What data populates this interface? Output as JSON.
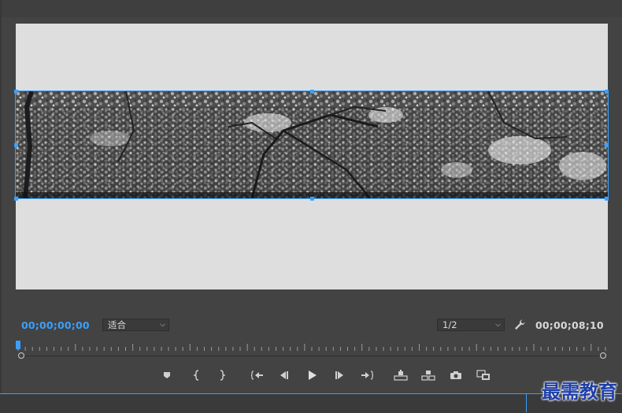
{
  "program_monitor": {
    "current_timecode": "00;00;00;00",
    "duration_timecode": "00;00;08;10",
    "zoom_level": "适合",
    "playback_resolution": "1/2"
  },
  "transport_controls": [
    {
      "name": "add-marker-button",
      "icon": "marker-icon"
    },
    {
      "name": "mark-in-button",
      "icon": "mark-in-icon"
    },
    {
      "name": "mark-out-button",
      "icon": "mark-out-icon"
    },
    {
      "name": "go-to-in-button",
      "icon": "go-to-in-icon"
    },
    {
      "name": "step-back-button",
      "icon": "step-back-icon"
    },
    {
      "name": "play-button",
      "icon": "play-icon"
    },
    {
      "name": "step-forward-button",
      "icon": "step-forward-icon"
    },
    {
      "name": "go-to-out-button",
      "icon": "go-to-out-icon"
    },
    {
      "name": "lift-button",
      "icon": "lift-icon"
    },
    {
      "name": "extract-button",
      "icon": "extract-icon"
    },
    {
      "name": "export-frame-button",
      "icon": "camera-icon"
    },
    {
      "name": "compare-view-button",
      "icon": "compare-icon"
    }
  ],
  "colors": {
    "accent": "#3aa0ff",
    "panel_bg": "#434343",
    "canvas_bg": "#dedede"
  },
  "watermark": "最需教育"
}
